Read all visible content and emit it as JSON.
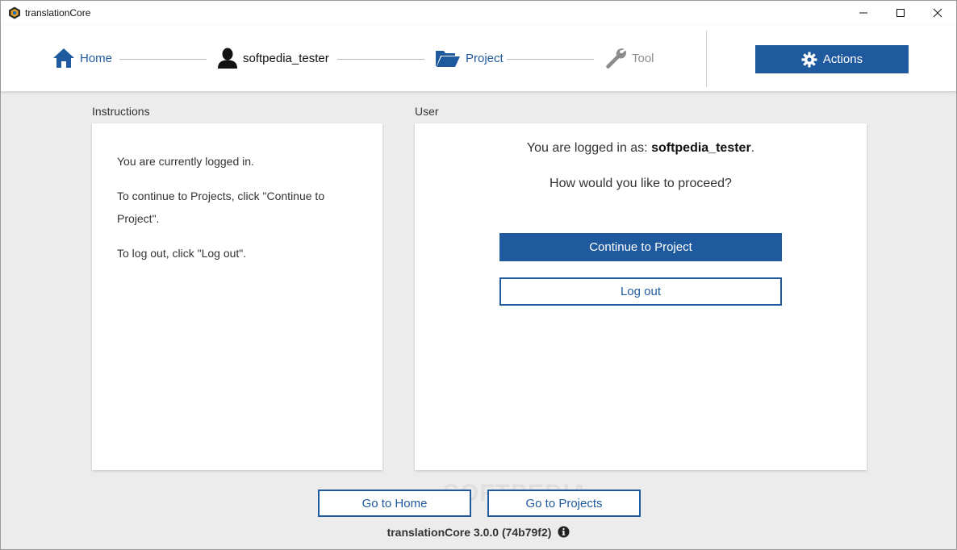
{
  "window": {
    "title": "translationCore"
  },
  "stepper": {
    "home_label": "Home",
    "user_label": "softpedia_tester",
    "project_label": "Project",
    "tool_label": "Tool"
  },
  "actions": {
    "label": "Actions"
  },
  "instructions": {
    "section_label": "Instructions",
    "line1": "You are currently logged in.",
    "line2": "To continue to Projects, click \"Continue to Project\".",
    "line3": "To log out, click \"Log out\"."
  },
  "user": {
    "section_label": "User",
    "logged_in_prefix": "You are logged in as: ",
    "username": "softpedia_tester",
    "logged_in_suffix": ".",
    "question": "How would you like to proceed?",
    "continue_label": "Continue to Project",
    "logout_label": "Log out"
  },
  "footer": {
    "go_home_label": "Go to Home",
    "go_projects_label": "Go to Projects",
    "version": "translationCore 3.0.0 (74b79f2)"
  },
  "watermark": "SOFTPEDIA",
  "colors": {
    "accent": "#1f5a9e",
    "background": "#ececec",
    "disabled": "#8c8c8c"
  }
}
